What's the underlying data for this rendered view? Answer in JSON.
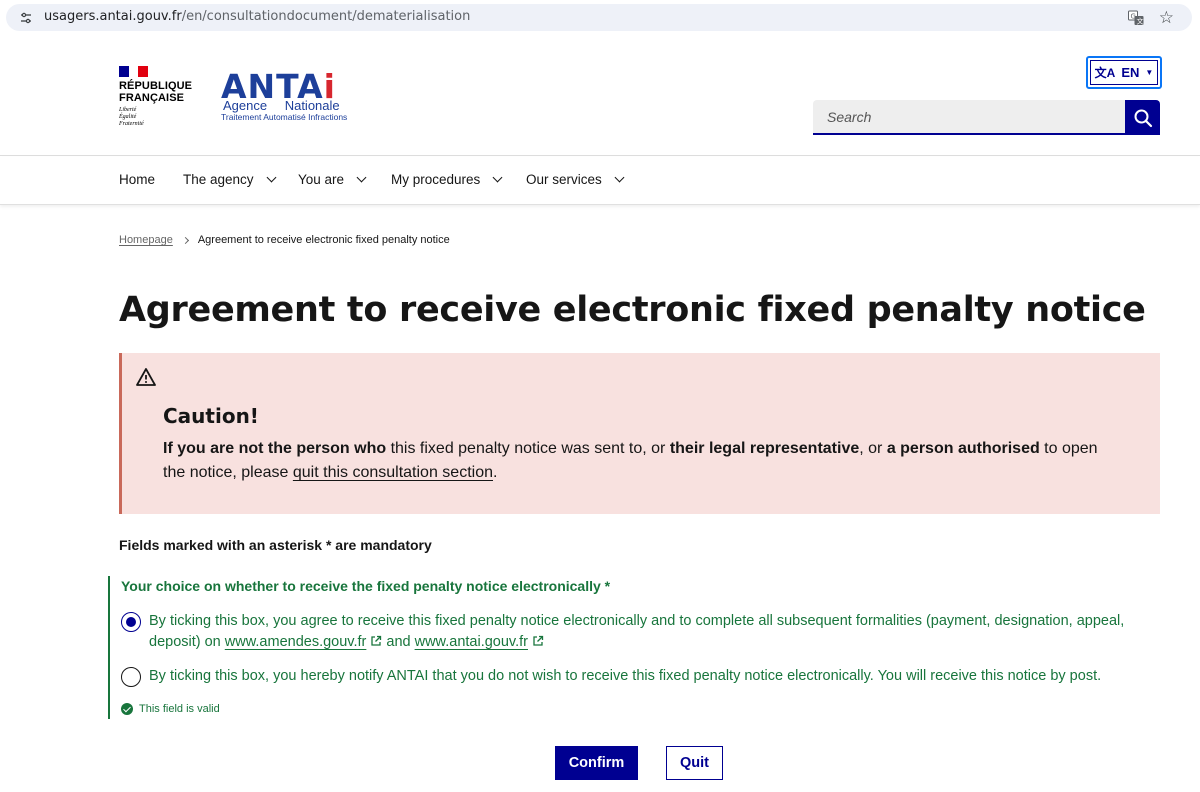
{
  "browser": {
    "url_host": "usagers.antai.gouv.fr",
    "url_path": "/en/consultationdocument/dematerialisation",
    "icons": [
      "site-info-icon",
      "translate-icon",
      "star-icon"
    ]
  },
  "header": {
    "rf_line1": "RÉPUBLIQUE",
    "rf_line2": "FRANÇAISE",
    "rf_motto1": "Liberté",
    "rf_motto2": "Égalité",
    "rf_motto3": "Fraternité",
    "antai_word": "ANTA",
    "antai_i": "i",
    "antai_line1": "Agence Nationale",
    "antai_line2": "Traitement Automatisé Infractions",
    "lang_label": "EN",
    "search_placeholder": "Search",
    "colors": {
      "brand_blue": "#000091",
      "flag_red": "#e1000f",
      "antai_blue": "#1d3f9a",
      "antai_red": "#d7262e"
    }
  },
  "nav": {
    "items": [
      {
        "label": "Home",
        "has_dropdown": false
      },
      {
        "label": "The agency",
        "has_dropdown": true
      },
      {
        "label": "You are",
        "has_dropdown": true
      },
      {
        "label": "My procedures",
        "has_dropdown": true
      },
      {
        "label": "Our services",
        "has_dropdown": true
      }
    ]
  },
  "breadcrumb": {
    "home": "Homepage",
    "current": "Agreement to receive electronic fixed penalty notice"
  },
  "page_title": "Agreement to receive electronic fixed penalty notice",
  "alert": {
    "title": "Caution!",
    "b1": "If you are not the person who",
    "t1": " this fixed penalty notice was sent to, or ",
    "b2": "their legal representative",
    "t2": ", or ",
    "b3": "a person authorised",
    "t3": " to open the notice, please ",
    "link": "quit this consultation section",
    "t4": ".",
    "colors": {
      "background": "#f8e1df",
      "border": "#c9695a"
    }
  },
  "form": {
    "mandatory_note": "Fields marked with an asterisk * are mandatory",
    "legend": "Your choice on whether to receive the fixed penalty notice electronically *",
    "option1": {
      "text": "By ticking this box, you agree to receive this fixed penalty notice electronically and to complete all subsequent formalities (payment, designation, appeal, deposit) on ",
      "link1": "www.amendes.gouv.fr",
      "and": " and ",
      "link2": "www.antai.gouv.fr",
      "checked": true
    },
    "option2": {
      "text": "By ticking this box, you hereby notify ANTAI that you do not wish to receive this fixed penalty notice electronically. You will receive this notice by post.",
      "checked": false
    },
    "valid_message": "This field is valid",
    "colors": {
      "valid_green": "#18753c"
    }
  },
  "actions": {
    "confirm": "Confirm",
    "quit": "Quit"
  }
}
